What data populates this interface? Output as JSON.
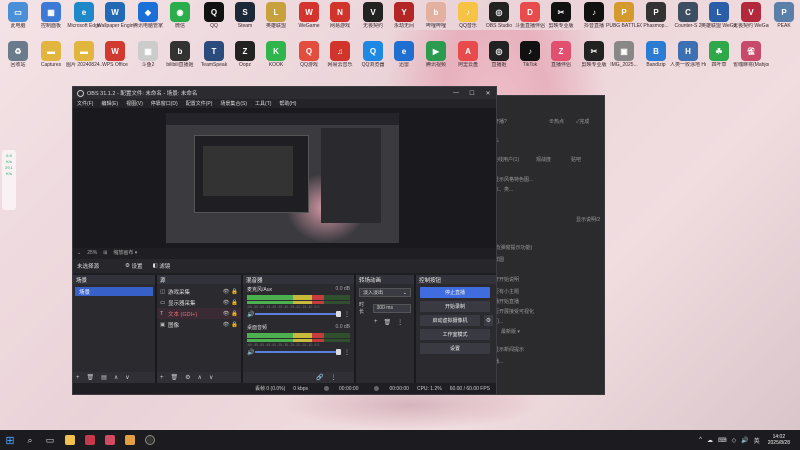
{
  "desktop_icons": [
    {
      "label": "此电脑",
      "color": "#4a90d9",
      "glyph": "▭"
    },
    {
      "label": "控制面板",
      "color": "#3c7ad6",
      "glyph": "▦"
    },
    {
      "label": "Microsoft Edge",
      "color": "#1e88c9",
      "glyph": "e"
    },
    {
      "label": "Wallpaper Engine",
      "color": "#2469b4",
      "glyph": "W"
    },
    {
      "label": "腾讯电脑管家",
      "color": "#1c6fd6",
      "glyph": "◆"
    },
    {
      "label": "微信",
      "color": "#2bad4c",
      "glyph": "◉"
    },
    {
      "label": "QQ",
      "color": "#111",
      "glyph": "Q"
    },
    {
      "label": "Steam",
      "color": "#1b2838",
      "glyph": "S"
    },
    {
      "label": "英雄联盟",
      "color": "#c8a13c",
      "glyph": "L"
    },
    {
      "label": "WeGame",
      "color": "#d3352e",
      "glyph": "W"
    },
    {
      "label": "网易游戏",
      "color": "#d0342b",
      "glyph": "N"
    },
    {
      "label": "无畏契约",
      "color": "#222",
      "glyph": "V"
    },
    {
      "label": "永劫无间",
      "color": "#b32626",
      "glyph": "Y"
    },
    {
      "label": "哔哩哔哩",
      "color": "#e4b0a0",
      "glyph": "b"
    },
    {
      "label": "QQ音乐",
      "color": "#f6c344",
      "glyph": "♪"
    },
    {
      "label": "OBS Studio",
      "color": "#222",
      "glyph": "◎"
    },
    {
      "label": "斗鱼直播伴侣",
      "color": "#e84b4b",
      "glyph": "D"
    },
    {
      "label": "剪映专业版",
      "color": "#111",
      "glyph": "✂"
    },
    {
      "label": "抖音直播",
      "color": "#111",
      "glyph": "♪"
    },
    {
      "label": "PUBG BATTLEGR...",
      "color": "#d49a2d",
      "glyph": "P"
    },
    {
      "label": "Phasmop...",
      "color": "#333",
      "glyph": "P"
    },
    {
      "label": "Counter-S 2",
      "color": "#3d4e63",
      "glyph": "C"
    },
    {
      "label": "英雄联盟 WeGame版",
      "color": "#2a5ea8",
      "glyph": "L"
    },
    {
      "label": "无畏契约 WeGame版",
      "color": "#b3293c",
      "glyph": "V"
    },
    {
      "label": "PEAK",
      "color": "#5a7fa8",
      "glyph": "P"
    }
  ],
  "desktop_icons_row2": [
    {
      "label": "回收站",
      "color": "#6a7b8b",
      "glyph": "♻"
    },
    {
      "label": "Captures",
      "color": "#e2b53f",
      "glyph": "▬"
    },
    {
      "label": "图片 20240824...",
      "color": "#e2b53f",
      "glyph": "▬"
    },
    {
      "label": "WPS Office",
      "color": "#d23a2f",
      "glyph": "W"
    },
    {
      "label": "斗鱼2",
      "color": "#ccc",
      "glyph": "▦"
    },
    {
      "label": "bilibili直播姬",
      "color": "#333",
      "glyph": "b"
    },
    {
      "label": "TeamSpeak",
      "color": "#2a4b7c",
      "glyph": "T"
    },
    {
      "label": "Oopz",
      "color": "#222",
      "glyph": "Z"
    },
    {
      "label": "KOOK",
      "color": "#2fb54b",
      "glyph": "K"
    },
    {
      "label": "QQ游戏",
      "color": "#e24d3d",
      "glyph": "Q"
    },
    {
      "label": "网易云音乐",
      "color": "#d0342b",
      "glyph": "♫"
    },
    {
      "label": "QQ浏览器",
      "color": "#1e88e5",
      "glyph": "Q"
    },
    {
      "label": "迅雷",
      "color": "#1e6fd0",
      "glyph": "e"
    },
    {
      "label": "腾讯视频",
      "color": "#2a9b4f",
      "glyph": "▶"
    },
    {
      "label": "阿里云盘",
      "color": "#e84b4b",
      "glyph": "A"
    },
    {
      "label": "直播姬",
      "color": "#222",
      "glyph": "◎"
    },
    {
      "label": "TikTok",
      "color": "#111",
      "glyph": "♪"
    },
    {
      "label": "直播伴侣",
      "color": "#e34f6f",
      "glyph": "Z"
    },
    {
      "label": "剪映专业版",
      "color": "#222",
      "glyph": "✂"
    },
    {
      "label": "IMG_2025...",
      "color": "#888",
      "glyph": "▣"
    },
    {
      "label": "Bandizip",
      "color": "#2c7cd4",
      "glyph": "B"
    },
    {
      "label": "人类一败涂地 Human Fa...",
      "color": "#3d6fb3",
      "glyph": "H"
    },
    {
      "label": "四叶草",
      "color": "#2fa84a",
      "glyph": "☘"
    },
    {
      "label": "雀魂麻将(Mahjong...",
      "color": "#c74a6a",
      "glyph": "雀"
    }
  ],
  "side_widget": {
    "line1": "6.9",
    "line2": "K/s",
    "line3": "29.1",
    "line4": "K/s"
  },
  "bg_window": {
    "rows": [
      "时开播?",
      "⊕热点",
      "✓完成",
      "助手",
      "连线用户(1)",
      "观战度",
      "贴吧",
      "是显示风格特色图...",
      "在本、类...",
      "...",
      "显示说明/2",
      "新增(弹窗提示功能)",
      "进群圆",
      "是开开始说明",
      "是否有小主题",
      "主播开始直播",
      "是否开展接受可视化",
      "入门...",
      "最新版 ▾",
      "是显示新闻提示",
      "直播..."
    ]
  },
  "obs": {
    "title": "OBS 31.1.2 - 配置文件: 未命名 - 场景: 未命名",
    "title_controls": [
      "—",
      "☐",
      "✕"
    ],
    "menu": [
      "文件(F)",
      "编辑(E)",
      "视图(V)",
      "停靠窗口(D)",
      "配置文件(P)",
      "场景集合(S)",
      "工具(T)",
      "帮助(H)"
    ],
    "zoom": [
      "⌄",
      "25%",
      "⊞",
      "缩放画布 ▾"
    ],
    "scene_label": "未选择源",
    "settings_btn": "设置",
    "filters_btn": "滤镜",
    "docks": {
      "scenes": {
        "title": "场景",
        "items": [
          "场景"
        ]
      },
      "sources": {
        "title": "源",
        "items": [
          {
            "icon": "◫",
            "name": "游戏采集",
            "selected": false
          },
          {
            "icon": "▭",
            "name": "显示器采集",
            "selected": false
          },
          {
            "icon": "T",
            "name": "文本 (GDI+)",
            "selected": true
          },
          {
            "icon": "▣",
            "name": "图像",
            "selected": false
          }
        ]
      },
      "mixer": {
        "title": "混音器",
        "channels": [
          {
            "name": "麦克风/Aux",
            "db": "0.0 dB"
          },
          {
            "name": "桌面音频",
            "db": "0.0 dB"
          }
        ],
        "ticks": "-60 -55 -50 -45 -40 -35 -30 -25 -20 -15 -10 -5 0"
      },
      "transitions": {
        "title": "转场动画",
        "selected": "淡入淡出",
        "duration_label": "时长",
        "duration_value": "300 ms"
      },
      "controls": {
        "title": "控制按钮",
        "buttons": [
          "停止直播",
          "开始录制",
          "启动虚拟摄像机",
          "工作室模式",
          "设置"
        ]
      }
    },
    "status": {
      "frames": "丢帧 0 (0.0%)",
      "kbps": "0 kbps",
      "time1": "00:00:00",
      "time2": "00:00:00",
      "cpu": "CPU: 1.2%",
      "fps": "60.00 / 60.00 FPS"
    }
  },
  "taskbar": {
    "start": "⊞",
    "icons": [
      "search",
      "task-view",
      "file-explorer",
      "app-red",
      "app-pink",
      "app-cat",
      "obs"
    ],
    "tray": [
      "^",
      "☁",
      "⌨",
      "◇",
      "🔊",
      "英"
    ],
    "time": "14:02",
    "date": "2025/8/28"
  }
}
